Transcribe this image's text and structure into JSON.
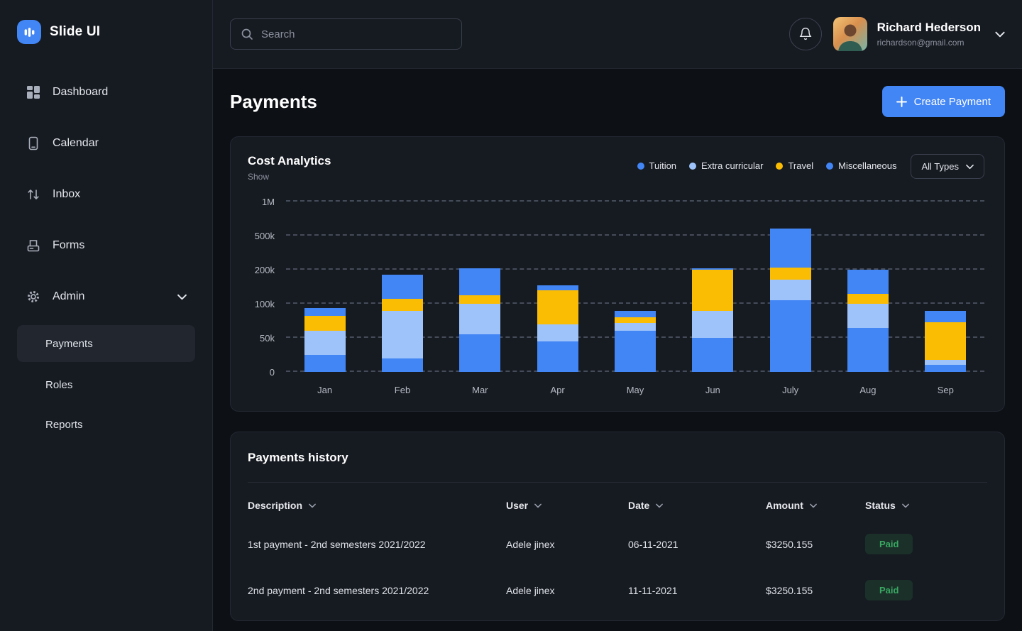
{
  "app": {
    "name": "Slide UI"
  },
  "colors": {
    "accent_blue": "#4285f4",
    "light_blue": "#9ec3fb",
    "yellow": "#fbbc04",
    "paid_bg": "rgba(52,168,83,0.16)",
    "paid_text": "#3aa862",
    "sidebar_bg": "#161a21",
    "content_bg": "#0d1015"
  },
  "icons": {
    "logo": "bar-chart-mark",
    "search": "magnifier",
    "notifications": "bell",
    "expand": "chevron-down",
    "create": "plus",
    "sort": "chevron-down"
  },
  "sidebar": {
    "items": [
      {
        "label": "Dashboard"
      },
      {
        "label": "Calendar"
      },
      {
        "label": "Inbox"
      },
      {
        "label": "Forms"
      },
      {
        "label": "Admin"
      }
    ],
    "admin_children": [
      {
        "label": "Payments",
        "active": true
      },
      {
        "label": "Roles",
        "active": false
      },
      {
        "label": "Reports",
        "active": false
      }
    ]
  },
  "topbar": {
    "search_placeholder": "Search",
    "user": {
      "name": "Richard Hederson",
      "email": "richardson@gmail.com"
    }
  },
  "page": {
    "title": "Payments",
    "create_button": "Create Payment"
  },
  "analytics": {
    "title": "Cost Analytics",
    "show_label": "Show",
    "filter_label": "All Types"
  },
  "chart_data": {
    "type": "bar",
    "stacked": true,
    "title": "Cost Analytics",
    "categories": [
      "Jan",
      "Feb",
      "Mar",
      "Apr",
      "May",
      "Jun",
      "July",
      "Aug",
      "Sep"
    ],
    "series": [
      {
        "name": "Tuition",
        "color": "#4285f4",
        "values": [
          25000,
          20000,
          55000,
          45000,
          60000,
          50000,
          110000,
          65000,
          10000
        ]
      },
      {
        "name": "Extra curricular",
        "color": "#9ec3fb",
        "values": [
          35000,
          70000,
          45000,
          25000,
          12000,
          40000,
          60000,
          35000,
          8000
        ]
      },
      {
        "name": "Travel",
        "color": "#fbbc04",
        "values": [
          22000,
          25000,
          25000,
          70000,
          8000,
          110000,
          50000,
          30000,
          55000
        ]
      },
      {
        "name": "Miscellaneous",
        "color": "#4285f4",
        "values": [
          12000,
          70000,
          90000,
          15000,
          10000,
          15000,
          380000,
          70000,
          17000
        ]
      }
    ],
    "y_ticks": [
      {
        "value": 0,
        "label": "0"
      },
      {
        "value": 50000,
        "label": "50k"
      },
      {
        "value": 100000,
        "label": "100k"
      },
      {
        "value": 200000,
        "label": "200k"
      },
      {
        "value": 500000,
        "label": "500k"
      },
      {
        "value": 1000000,
        "label": "1M"
      }
    ],
    "ylim": [
      0,
      1000000
    ],
    "grid": "dashed-horizontal",
    "legend_position": "top-right",
    "xlabel": "",
    "ylabel": ""
  },
  "payments_history": {
    "title": "Payments history",
    "columns": [
      "Description",
      "User",
      "Date",
      "Amount",
      "Status"
    ],
    "rows": [
      {
        "description": "1st payment - 2nd semesters 2021/2022",
        "user": "Adele jinex",
        "date": "06-11-2021",
        "amount": "$3250.155",
        "status": "Paid"
      },
      {
        "description": "2nd payment - 2nd semesters 2021/2022",
        "user": "Adele jinex",
        "date": "11-11-2021",
        "amount": "$3250.155",
        "status": "Paid"
      }
    ]
  }
}
